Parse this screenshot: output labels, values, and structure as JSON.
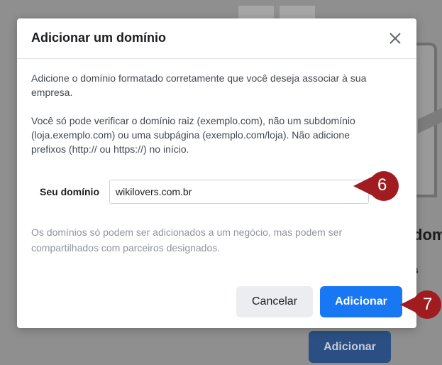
{
  "background": {
    "heading_fragment": "dom",
    "small_fragment": "s",
    "add_button_label": "Adicionar"
  },
  "dialog": {
    "title": "Adicionar um domínio",
    "close_icon": "close-icon",
    "intro": "Adicione o domínio formatado corretamente que você deseja associar à sua empresa.",
    "instructions": "Você só pode verificar o domínio raiz (exemplo.com), não um subdomínio (loja.exemplo.com) ou uma subpágina (exemplo.com/loja). Não adicione prefixos (http:// ou https://) no início.",
    "domain_field": {
      "label": "Seu domínio",
      "value": "wikilovers.com.br"
    },
    "note": "Os domínios só podem ser adicionados a um negócio, mas podem ser compartilhados com parceiros designados.",
    "cancel_label": "Cancelar",
    "add_label": "Adicionar"
  },
  "annotations": {
    "step_6": "6",
    "step_7": "7",
    "color": "#a01c20"
  },
  "colors": {
    "primary": "#1877f2",
    "cancel_bg": "#ebedf0"
  }
}
